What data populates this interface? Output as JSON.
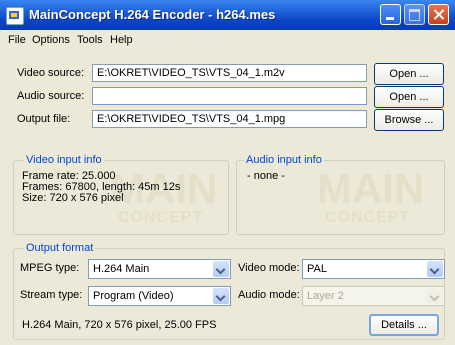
{
  "window": {
    "title": "MainConcept H.264 Encoder - h264.mes"
  },
  "menu": [
    "File",
    "Options",
    "Tools",
    "Help"
  ],
  "sources": {
    "video_label": "Video source:",
    "video_value": "E:\\OKRET\\VIDEO_TS\\VTS_04_1.m2v",
    "audio_label": "Audio source:",
    "audio_value": "",
    "output_label": "Output file:",
    "output_value": "E:\\OKRET\\VIDEO_TS\\VTS_04_1.mpg",
    "open_label": "Open ...",
    "open_label_2": "Open ...",
    "browse_label": "Browse ..."
  },
  "video_info": {
    "title": "Video input info",
    "line1": "Frame rate: 25.000",
    "line2": "Frames: 67800, length: 45m 12s",
    "line3": "Size: 720 x 576 pixel"
  },
  "audio_info": {
    "title": "Audio input info",
    "line1": "- none -"
  },
  "watermark": {
    "main": "MAIN",
    "sub": "CONCEPT"
  },
  "output_format": {
    "title": "Output format",
    "mpeg_label": "MPEG type:",
    "mpeg_value": "H.264 Main",
    "stream_label": "Stream type:",
    "stream_value": "Program (Video)",
    "video_mode_label": "Video mode:",
    "video_mode_value": "PAL",
    "audio_mode_label": "Audio mode:",
    "audio_mode_value": "Layer 2",
    "summary": "H.264 Main, 720 x 576 pixel, 25.00 FPS",
    "details_label": "Details ..."
  }
}
